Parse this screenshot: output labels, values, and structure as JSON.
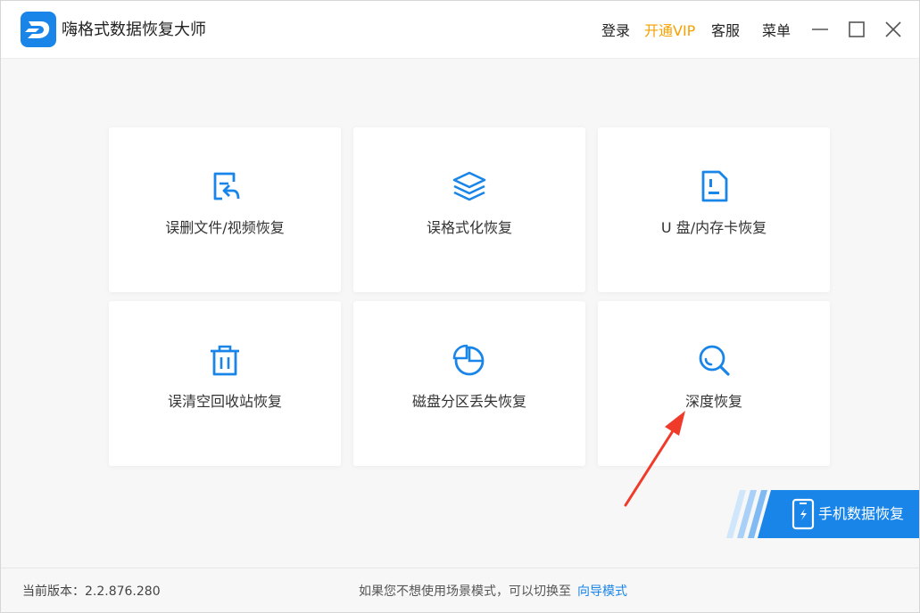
{
  "app": {
    "title": "嗨格式数据恢复大师"
  },
  "topbar": {
    "login": "登录",
    "vip": "开通VIP",
    "service": "客服",
    "menu": "菜单"
  },
  "cards": [
    {
      "label": "误删文件/视频恢复",
      "icon": "file-restore-icon"
    },
    {
      "label": "误格式化恢复",
      "icon": "layers-icon"
    },
    {
      "label": "U 盘/内存卡恢复",
      "icon": "sd-card-icon"
    },
    {
      "label": "误清空回收站恢复",
      "icon": "trash-icon"
    },
    {
      "label": "磁盘分区丢失恢复",
      "icon": "pie-chart-icon"
    },
    {
      "label": "深度恢复",
      "icon": "search-icon"
    }
  ],
  "phone_banner": {
    "label": "手机数据恢复",
    "icon": "phone-icon"
  },
  "footer": {
    "version": "当前版本：2.2.876.280",
    "hint": "如果您不想使用场景模式，可以切换至",
    "guide_link": "向导模式"
  },
  "colors": {
    "accent": "#1a85e8",
    "vip": "#f5a100",
    "annotation_arrow": "#f03a2a"
  }
}
